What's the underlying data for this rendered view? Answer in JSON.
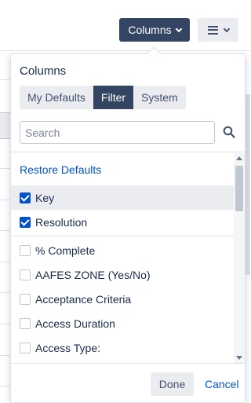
{
  "toolbar": {
    "columns_label": "Columns",
    "more_icon": "hamburger-icon"
  },
  "panel": {
    "title": "Columns",
    "tabs": [
      {
        "label": "My Defaults",
        "active": false
      },
      {
        "label": "Filter",
        "active": true
      },
      {
        "label": "System",
        "active": false
      }
    ],
    "search": {
      "placeholder": "Search",
      "value": ""
    },
    "restore_label": "Restore Defaults",
    "items": [
      {
        "label": "Key",
        "checked": true,
        "highlighted": true
      },
      {
        "label": "Resolution",
        "checked": true,
        "highlighted": false
      },
      {
        "label": "% Complete",
        "checked": false,
        "highlighted": false
      },
      {
        "label": "AAFES ZONE (Yes/No)",
        "checked": false,
        "highlighted": false
      },
      {
        "label": "Acceptance Criteria",
        "checked": false,
        "highlighted": false
      },
      {
        "label": "Access Duration",
        "checked": false,
        "highlighted": false
      },
      {
        "label": "Access Type:",
        "checked": false,
        "highlighted": false
      }
    ],
    "done_label": "Done",
    "cancel_label": "Cancel"
  },
  "colors": {
    "primary_dark": "#344563",
    "link_blue": "#0052cc",
    "checkbox_blue": "#0052cc",
    "neutral_bg": "#ebecf0"
  }
}
